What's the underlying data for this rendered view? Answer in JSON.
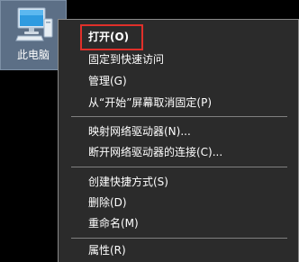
{
  "desktop": {
    "icon": {
      "label": "此电脑",
      "icon_name": "computer-icon",
      "selected": true,
      "selection_color": "#5c6f86"
    }
  },
  "context_menu": {
    "background_color": "#2b2b2b",
    "items": [
      {
        "label": "打开(O)",
        "bold": true
      },
      {
        "label": "固定到快速访问"
      },
      {
        "label": "管理(G)"
      },
      {
        "label": "从“开始”屏幕取消固定(P)"
      },
      {
        "label": "映射网络驱动器(N)..."
      },
      {
        "label": "断开网络驱动器的连接(C)..."
      },
      {
        "label": "创建快捷方式(S)"
      },
      {
        "label": "删除(D)"
      },
      {
        "label": "重命名(M)"
      },
      {
        "label": "属性(R)"
      }
    ]
  },
  "annotation": {
    "highlight_color": "#e0302a",
    "target": "打开(O)"
  }
}
